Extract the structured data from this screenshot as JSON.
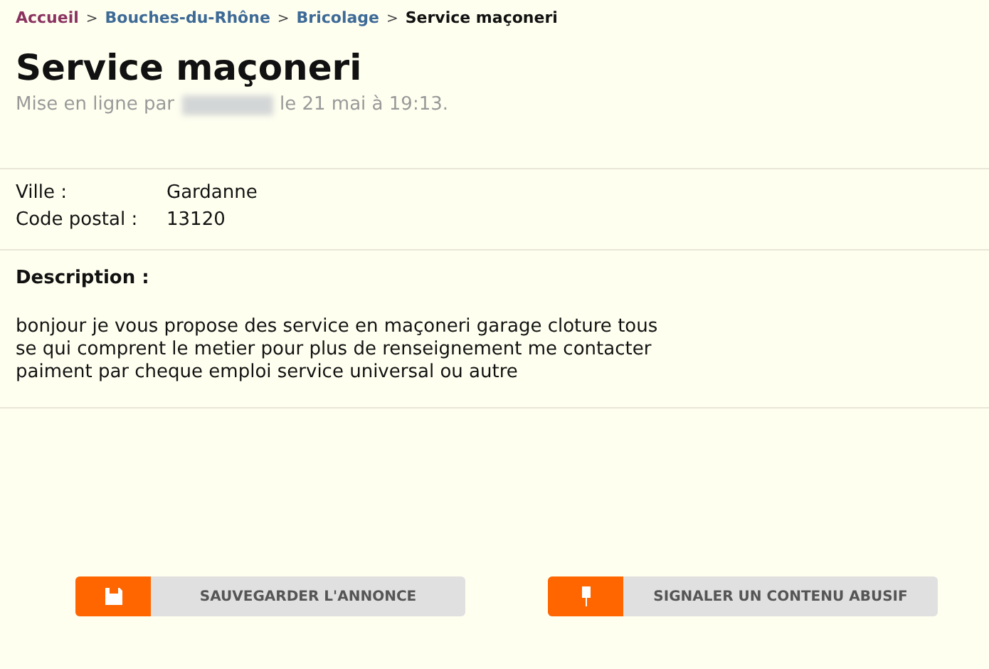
{
  "breadcrumb": [
    {
      "kind": "link",
      "label": "Accueil",
      "visited": true
    },
    {
      "kind": "separator",
      "label": ">"
    },
    {
      "kind": "link",
      "label": "Bouches-du-Rhône",
      "visited": false
    },
    {
      "kind": "separator",
      "label": ">"
    },
    {
      "kind": "link",
      "label": "Bricolage",
      "visited": false
    },
    {
      "kind": "separator",
      "label": ">"
    },
    {
      "kind": "current",
      "label": "Service maçoneri"
    }
  ],
  "title": "Service maçoneri",
  "posted": {
    "prefix": "Mise en ligne par",
    "suffix": "le 21 mai à 19:13."
  },
  "details": [
    {
      "label": "Ville :",
      "value": "Gardanne"
    },
    {
      "label": "Code postal :",
      "value": "13120"
    }
  ],
  "description": {
    "heading": "Description :",
    "text": "bonjour je vous propose des service en maçoneri garage cloture tous\nse qui comprent le metier pour plus de renseignement me contacter\npaiment par cheque emploi service universal ou autre"
  },
  "buttons": [
    {
      "kind": "save",
      "label": "SAUVEGARDER L'ANNONCE"
    },
    {
      "kind": "report",
      "label": "SIGNALER UN CONTENU ABUSIF"
    }
  ]
}
